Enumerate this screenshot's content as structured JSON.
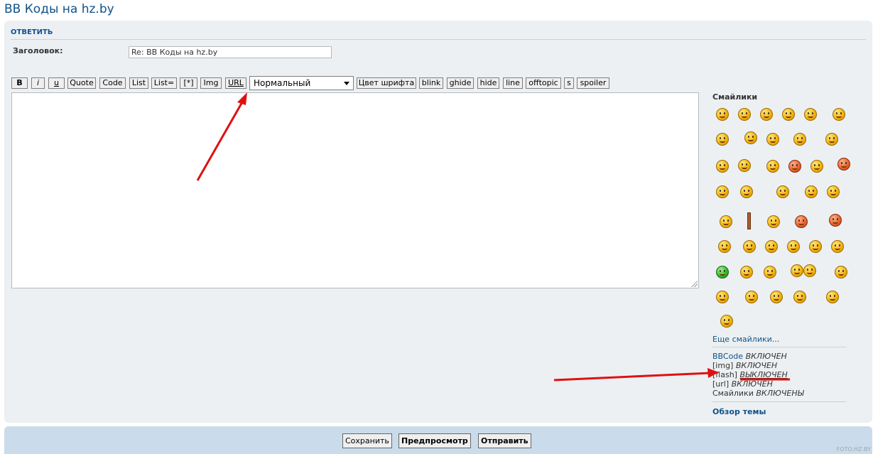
{
  "page": {
    "title": "BB Коды на hz.by"
  },
  "panel": {
    "heading": "ОТВЕТИТЬ",
    "subject_label": "Заголовок:",
    "subject_value": "Re: BB Коды на hz.by"
  },
  "toolbar": {
    "b": "B",
    "i": "i",
    "u": "u",
    "quote": "Quote",
    "code": "Code",
    "list": "List",
    "list_eq": "List=",
    "list_item": "[*]",
    "img": "Img",
    "url": "URL",
    "font_size": "Нормальный",
    "font_color": "Цвет шрифта",
    "blink": "blink",
    "ghide": "ghide",
    "hide": "hide",
    "line": "line",
    "offtopic": "offtopic",
    "s": "s",
    "spoiler": "spoiler"
  },
  "smilies": {
    "title": "Смайлики",
    "more": "Еще смайлики..."
  },
  "status": {
    "bbcode_label": "BBCode",
    "bbcode_value": "ВКЛЮЧЕН",
    "img_label": "[img]",
    "img_value": "ВКЛЮЧЕН",
    "flash_label": "[flash]",
    "flash_value": "ВЫКЛЮЧЕН",
    "url_label": "[url]",
    "url_value": "ВКЛЮЧЕН",
    "smilies_label": "Смайлики",
    "smilies_value": "ВКЛЮЧЕНЫ"
  },
  "topic_review": "Обзор темы",
  "actions": {
    "save": "Сохранить",
    "preview": "Предпросмотр",
    "submit": "Отправить"
  },
  "watermark": "FOTO.HZ.BY",
  "colors": {
    "link": "#105289",
    "panel_bg": "#ecf0f2",
    "bottom_bar_bg": "#cadceb",
    "arrow": "#e01010"
  }
}
